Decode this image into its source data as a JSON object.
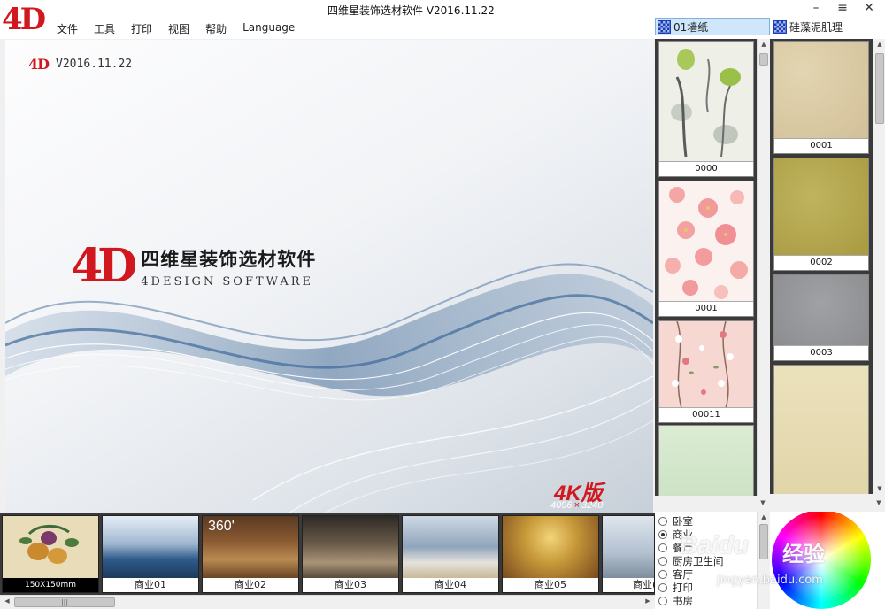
{
  "window": {
    "title": "四维星装饰选材软件  V2016.11.22",
    "controls": [
      "–",
      "≡",
      "✕"
    ]
  },
  "app": {
    "logo": "4D"
  },
  "menu": [
    "文件",
    "工具",
    "打印",
    "视图",
    "帮助",
    "Language"
  ],
  "category_tabs": [
    {
      "label": "01墙纸",
      "active": true
    },
    {
      "label": "硅藻泥肌理",
      "active": false
    }
  ],
  "splash": {
    "mini_logo": "4D",
    "version": "V2016.11.22",
    "logo": "4D",
    "name_cn": "四维星装饰选材软件",
    "name_en": "4DESIGN SOFTWARE",
    "badge": "4K版",
    "res_w": "4096",
    "res_x": "×",
    "res_h": "3240"
  },
  "wallpaper_swatches": [
    {
      "label": "0000",
      "colors": [
        "#eef0e8",
        "#9bc04a"
      ]
    },
    {
      "label": "0001",
      "colors": [
        "#fbf1ee",
        "#f2a0a0"
      ]
    },
    {
      "label": "00011",
      "colors": [
        "#f6d7d2",
        "#e07a82"
      ]
    },
    {
      "label": "",
      "colors": [
        "#d9ead2",
        "#c9e0c2"
      ]
    }
  ],
  "texture_swatches": [
    {
      "label": "0001",
      "color": "#d9c9a4"
    },
    {
      "label": "0002",
      "color": "#b2a550"
    },
    {
      "label": "0003",
      "color": "#96979a"
    },
    {
      "label": "",
      "color": "#e6dbb2"
    }
  ],
  "scenes": [
    {
      "label": "150X150mm"
    },
    {
      "label": "商业01"
    },
    {
      "label": "商业02",
      "badge": "360'"
    },
    {
      "label": "商业03"
    },
    {
      "label": "商业04"
    },
    {
      "label": "商业05"
    },
    {
      "label": "商业("
    }
  ],
  "hscroll_thumb": "|||",
  "room_types": [
    {
      "label": "卧室",
      "selected": false
    },
    {
      "label": "商业",
      "selected": true
    },
    {
      "label": "餐厅",
      "selected": false
    },
    {
      "label": "厨房卫生间",
      "selected": false
    },
    {
      "label": "客厅",
      "selected": false
    },
    {
      "label": "打印",
      "selected": false
    },
    {
      "label": "书房",
      "selected": false
    }
  ],
  "watermark": {
    "brand": "Baidu",
    "text": "经验",
    "url": "jingyan.baidu.com"
  }
}
